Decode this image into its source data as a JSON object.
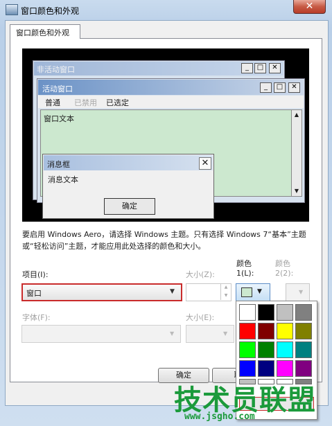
{
  "window": {
    "title": "窗口颜色和外观",
    "close_label": "✕"
  },
  "tab": {
    "label": "窗口颜色和外观"
  },
  "preview": {
    "inactive_title": "非活动窗口",
    "active_title": "活动窗口",
    "menu": [
      "普通",
      "已禁用",
      "已选定"
    ],
    "window_text": "窗口文本",
    "msgbox_title": "消息框",
    "msgbox_text": "消息文本",
    "msgbox_ok": "确定",
    "btn_min": "_",
    "btn_max": "□",
    "btn_close": "✕",
    "scroll_up": "▲",
    "scroll_down": "▼"
  },
  "description": "要启用 Windows Aero，请选择 Windows 主题。只有选择 Windows 7“基本”主题或“轻松访问”主题，才能应用此处选择的颜色和大小。",
  "item": {
    "label": "项目(I):",
    "value": "窗口"
  },
  "size1": {
    "label": "大小(Z):"
  },
  "color1": {
    "label_line1": "颜色",
    "label_line2": "1(L):",
    "value": "#cce8cf"
  },
  "color2": {
    "label_line1": "颜色",
    "label_line2": "2(2):"
  },
  "font": {
    "label": "字体(F):"
  },
  "size2": {
    "label": "大小(E):"
  },
  "palette": {
    "colors": [
      "#ffffff",
      "#000000",
      "#c0c0c0",
      "#808080",
      "#ff0000",
      "#800000",
      "#ffff00",
      "#808000",
      "#00ff00",
      "#008000",
      "#00ffff",
      "#008080",
      "#0000ff",
      "#000080",
      "#ff00ff",
      "#800080",
      "#c0c0c0",
      "#ffffff",
      "#ffffff",
      "#808080"
    ]
  },
  "buttons": {
    "ok": "确定",
    "cancel": "取"
  },
  "watermark": {
    "brand": "技术员联盟",
    "url": "www.jsgho.com"
  }
}
